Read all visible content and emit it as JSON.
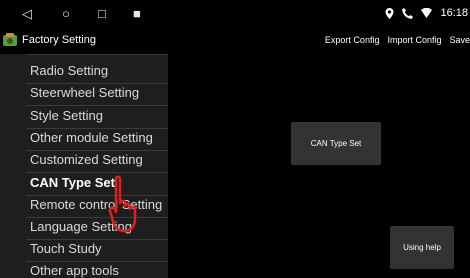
{
  "status_bar": {
    "nav_back": "◁",
    "nav_home": "○",
    "nav_recent": "□",
    "screenshot_icon": "■",
    "time": "16:18"
  },
  "app_bar": {
    "title": "Factory Setting",
    "actions": [
      "Export Config",
      "Import Config",
      "Save"
    ]
  },
  "menu": {
    "items": [
      "Radio Setting",
      "Steerwheel Setting",
      "Style Setting",
      "Other module Setting",
      "Customized Setting",
      "CAN Type Set",
      "Remote control Setting",
      "Language Setting",
      "Touch Study",
      "Other app tools"
    ],
    "selected_index": 5
  },
  "content": {
    "can_type_button": "CAN Type Set",
    "help_button": "Using help"
  },
  "colors": {
    "background": "#000000",
    "menu_background": "#1e1e1e",
    "button_background": "#333333",
    "hand_red": "#e0201c"
  }
}
